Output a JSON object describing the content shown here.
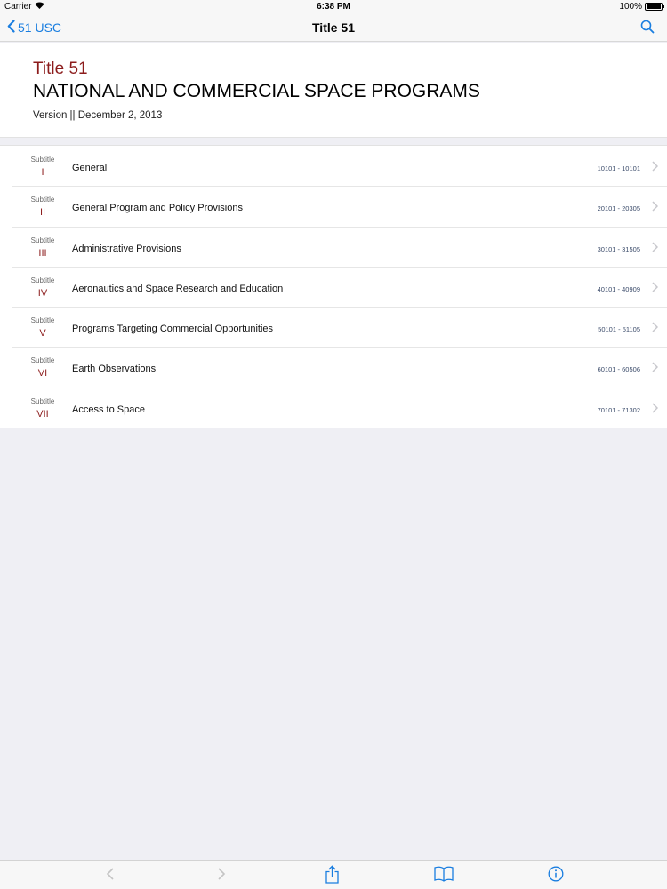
{
  "status_bar": {
    "carrier": "Carrier",
    "time": "6:38 PM",
    "battery": "100%"
  },
  "nav_bar": {
    "back_label": "51 USC",
    "title": "Title 51"
  },
  "header": {
    "title_number": "Title 51",
    "title_name": "NATIONAL AND COMMERCIAL SPACE PROGRAMS",
    "version": "Version || December 2, 2013"
  },
  "subtitles": [
    {
      "label": "Subtitle",
      "number": "I",
      "name": "General",
      "range": "10101 - 10101"
    },
    {
      "label": "Subtitle",
      "number": "II",
      "name": "General Program and Policy Provisions",
      "range": "20101 - 20305"
    },
    {
      "label": "Subtitle",
      "number": "III",
      "name": "Administrative Provisions",
      "range": "30101 - 31505"
    },
    {
      "label": "Subtitle",
      "number": "IV",
      "name": "Aeronautics and Space Research and Education",
      "range": "40101 - 40909"
    },
    {
      "label": "Subtitle",
      "number": "V",
      "name": "Programs Targeting Commercial Opportunities",
      "range": "50101 - 51105"
    },
    {
      "label": "Subtitle",
      "number": "VI",
      "name": "Earth Observations",
      "range": "60101 - 60506"
    },
    {
      "label": "Subtitle",
      "number": "VII",
      "name": "Access to Space",
      "range": "70101 - 71302"
    }
  ],
  "colors": {
    "accent": "#1a7ee0",
    "title_red": "#8c1c1c",
    "disabled": "#c4c4c4"
  },
  "icons": {
    "back": "chevron-left-icon",
    "search": "search-icon",
    "row": "chevron-right-icon",
    "toolbar": [
      "chevron-left-icon",
      "chevron-right-icon",
      "share-icon",
      "book-icon",
      "info-icon"
    ]
  }
}
